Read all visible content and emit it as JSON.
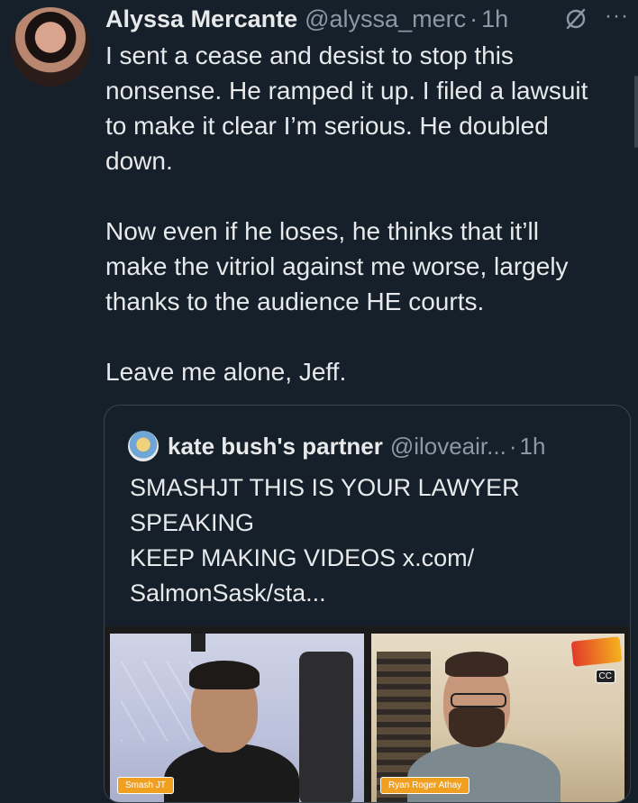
{
  "tweet": {
    "author_name": "Alyssa Mercante",
    "author_handle": "@alyssa_merc",
    "separator": "·",
    "time": "1h",
    "more_label": "···",
    "body": "I sent a cease and desist to stop this\nnonsense. He ramped it up. I filed a lawsuit\nto make it clear I’m serious. He doubled\ndown.\n\nNow even if he loses, he thinks that it’ll\nmake the vitriol against me worse, largely\nthanks to the audience HE courts.\n\nLeave me alone, Jeff."
  },
  "quote": {
    "author_name": "kate bush's partner",
    "author_handle": "@iloveair...",
    "separator": "·",
    "time": "1h",
    "body": "SMASHJT THIS IS YOUR LAWYER\nSPEAKING\nKEEP MAKING VIDEOS x.com/\nSalmonSask/sta...",
    "media": {
      "left_name_tag": "Smash JT",
      "right_name_tag": "Ryan Roger Athay",
      "cc_label": "CC"
    }
  },
  "colors": {
    "background": "#15202b",
    "text": "#e7e9ea",
    "muted": "#8b98a5",
    "border": "#38444d"
  }
}
